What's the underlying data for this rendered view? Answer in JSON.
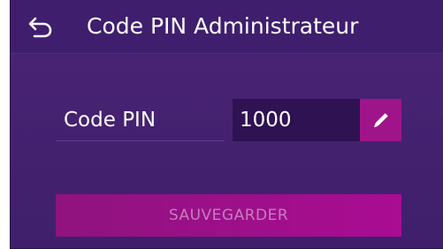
{
  "header": {
    "title": "Code PIN Administrateur",
    "back_icon": "back-arrow-icon"
  },
  "form": {
    "pin_label": "Code PIN",
    "pin_value": "1000",
    "edit_icon": "pencil-icon"
  },
  "actions": {
    "save_label": "SAUVEGARDER",
    "save_enabled": false
  },
  "colors": {
    "background": "#3f1f6b",
    "header": "#3f1e6e",
    "field": "#2f1252",
    "accent": "#a0148a",
    "disabled_text": "#c67dbe"
  }
}
